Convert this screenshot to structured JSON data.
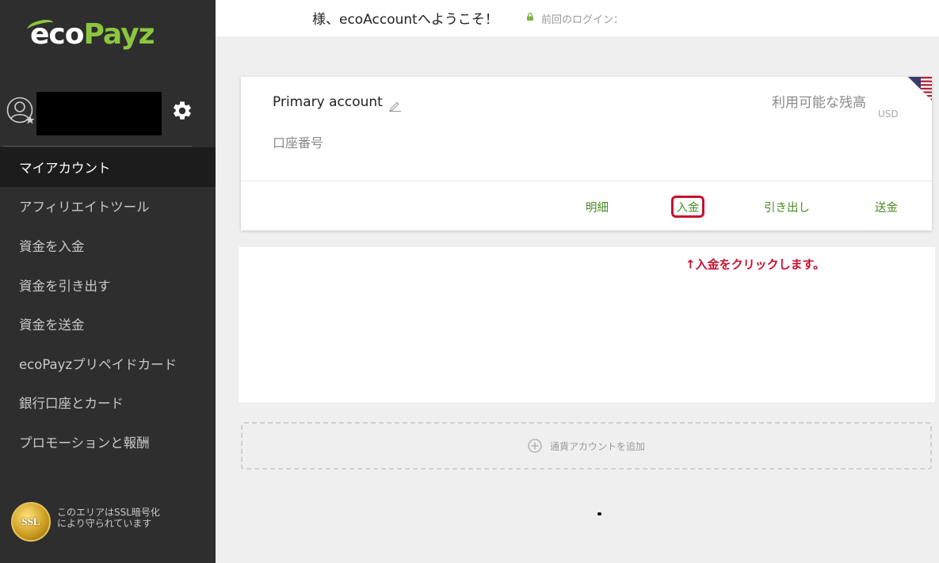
{
  "app": {
    "logo": {
      "eco": "eco",
      "payz": "Payz"
    }
  },
  "header": {
    "welcome": "様、ecoAccountへようこそ！",
    "last_login": "前回のログイン："
  },
  "sidebar": {
    "items": [
      {
        "label": "マイアカウント",
        "active": true
      },
      {
        "label": "アフィリエイトツール",
        "active": false
      },
      {
        "label": "資金を入金",
        "active": false
      },
      {
        "label": "資金を引き出す",
        "active": false
      },
      {
        "label": "資金を送金",
        "active": false
      },
      {
        "label": "ecoPayzプリペイドカード",
        "active": false
      },
      {
        "label": "銀行口座とカード",
        "active": false
      },
      {
        "label": "プロモーションと報酬",
        "active": false
      }
    ],
    "ssl": {
      "badge": "SSL",
      "text": "このエリアはSSL暗号化により守られています"
    }
  },
  "account_card": {
    "name": "Primary account",
    "number_label": "口座番号",
    "balance_label": "利用可能な残高",
    "currency": "USD",
    "actions": {
      "statement": "明細",
      "deposit": "入金",
      "withdraw": "引き出し",
      "transfer": "送金"
    }
  },
  "annotation": "↑入金をクリックします。",
  "add_currency": {
    "label": "通貨アカウントを追加"
  },
  "colors": {
    "sidebar_bg": "#2e2e2e",
    "accent_green": "#8cc63f",
    "action_green": "#4a8c23",
    "highlight_red": "#c8102e"
  }
}
